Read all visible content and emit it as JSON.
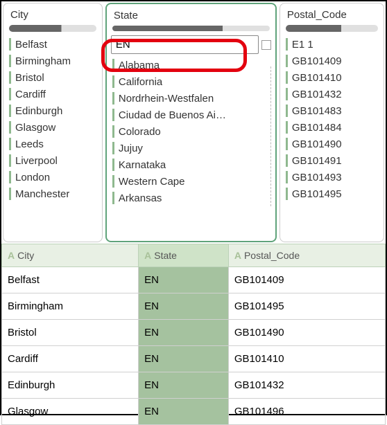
{
  "panels": {
    "city": {
      "header": "City",
      "items": [
        "Belfast",
        "Birmingham",
        "Bristol",
        "Cardiff",
        "Edinburgh",
        "Glasgow",
        "Leeds",
        "Liverpool",
        "London",
        "Manchester"
      ]
    },
    "state": {
      "header": "State",
      "filter_value": "EN",
      "items": [
        "Alabama",
        "California",
        "Nordrhein-Westfalen",
        "Ciudad de Buenos Ai…",
        "Colorado",
        "Jujuy",
        "Karnataka",
        "Western Cape",
        "Arkansas"
      ]
    },
    "postal": {
      "header": "Postal_Code",
      "items": [
        "E1 1",
        "GB101409",
        "GB101410",
        "GB101432",
        "GB101483",
        "GB101484",
        "GB101490",
        "GB101491",
        "GB101493",
        "GB101495"
      ]
    }
  },
  "table": {
    "type_prefix": "A",
    "columns": [
      "City",
      "State",
      "Postal_Code"
    ],
    "rows": [
      {
        "city": "Belfast",
        "state": "EN",
        "postal": "GB101409"
      },
      {
        "city": "Birmingham",
        "state": "EN",
        "postal": "GB101495"
      },
      {
        "city": "Bristol",
        "state": "EN",
        "postal": "GB101490"
      },
      {
        "city": "Cardiff",
        "state": "EN",
        "postal": "GB101410"
      },
      {
        "city": "Edinburgh",
        "state": "EN",
        "postal": "GB101432"
      },
      {
        "city": "Glasgow",
        "state": "EN",
        "postal": "GB101496"
      }
    ]
  }
}
